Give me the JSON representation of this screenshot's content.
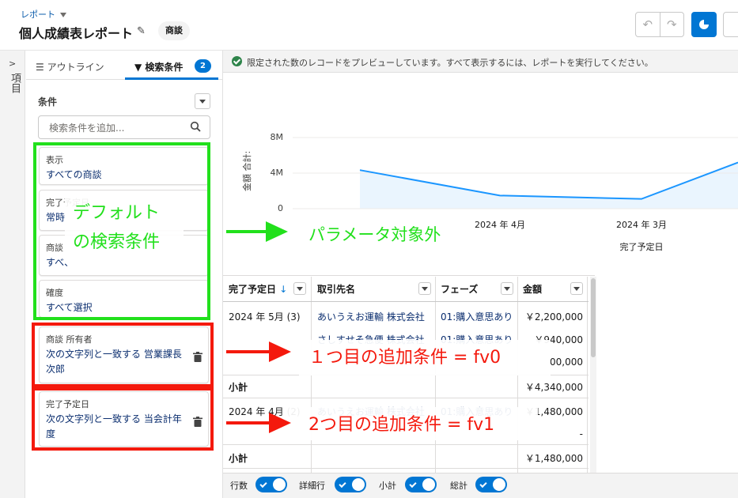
{
  "header": {
    "breadcrumb": "レポート",
    "title": "個人成績表レポート",
    "report_type": "商談"
  },
  "rail": {
    "label": "項目"
  },
  "panel": {
    "tabs": [
      {
        "label": "アウトライン"
      },
      {
        "label": "検索条件",
        "count": "2"
      }
    ],
    "conditions_label": "条件",
    "search_placeholder": "検索条件を追加...",
    "default_filters": [
      {
        "label": "表示",
        "value": "すべての商談"
      },
      {
        "label": "完了予定日",
        "value": "常時"
      },
      {
        "label": "商談",
        "value": "すべ、"
      },
      {
        "label": "確度",
        "value": "すべて選択"
      }
    ],
    "custom_filters": [
      {
        "label": "商談 所有者",
        "value": "次の文字列と一致する 営業課長 次郎"
      },
      {
        "label": "完了予定日",
        "value": "次の文字列と一致する 当会計年度"
      }
    ]
  },
  "notice": "限定された数のレコードをプレビューしています。すべて表示するには、レポートを実行してください。",
  "chart_data": {
    "type": "area",
    "ylabel": "金額 合計:",
    "xlabel": "完了予定日",
    "y_ticks": [
      "8M",
      "4M",
      "0"
    ],
    "x_ticks": [
      "2024 年 4月",
      "2024 年 3月"
    ],
    "ylim": [
      0,
      8000000
    ],
    "series": [
      {
        "values": [
          4340000,
          1480000,
          1100000,
          5200000
        ]
      }
    ],
    "line_color": "#1b96ff",
    "fill_color": "#eaf5fe"
  },
  "table": {
    "columns": [
      "完了予定日",
      "取引先名",
      "フェーズ",
      "金額"
    ],
    "rows": [
      {
        "date": "2024 年 5月 (3)",
        "account": "あいうえお運輸 株式会社",
        "phase": "01:購入意思あり",
        "amount": "￥2,200,000"
      },
      {
        "date": "",
        "account": "さしすせそ急便 株式会社",
        "phase": "01:購入意思あり",
        "amount": "￥940,000"
      },
      {
        "date": "",
        "account": "",
        "phase": "",
        "amount": "00,000"
      },
      {
        "date": "小計",
        "account": "",
        "phase": "",
        "amount": "￥4,340,000",
        "subtotal": true
      },
      {
        "date": "2024 年 4月 (2)",
        "account": "あいうえお運輸 株式会社",
        "phase": "01:購入意思あり",
        "amount": "￥1,480,000"
      },
      {
        "date": "",
        "account": "",
        "phase": "",
        "amount": "-"
      },
      {
        "date": "小計",
        "account": "",
        "phase": "",
        "amount": "￥1,480,000",
        "subtotal": true
      }
    ]
  },
  "footer_toggles": [
    {
      "label": "行数",
      "on": true
    },
    {
      "label": "詳細行",
      "on": true
    },
    {
      "label": "小計",
      "on": true
    },
    {
      "label": "総計",
      "on": true
    }
  ],
  "annotations": {
    "default_line1": "デフォルト",
    "default_line2": "の検索条件",
    "param_excluded": "パラメータ対象外",
    "fv0": "１つ目の追加条件 = fv0",
    "fv1": "2つ目の追加条件 = fv1",
    "green": "#22e01c",
    "red": "#f4190d"
  }
}
